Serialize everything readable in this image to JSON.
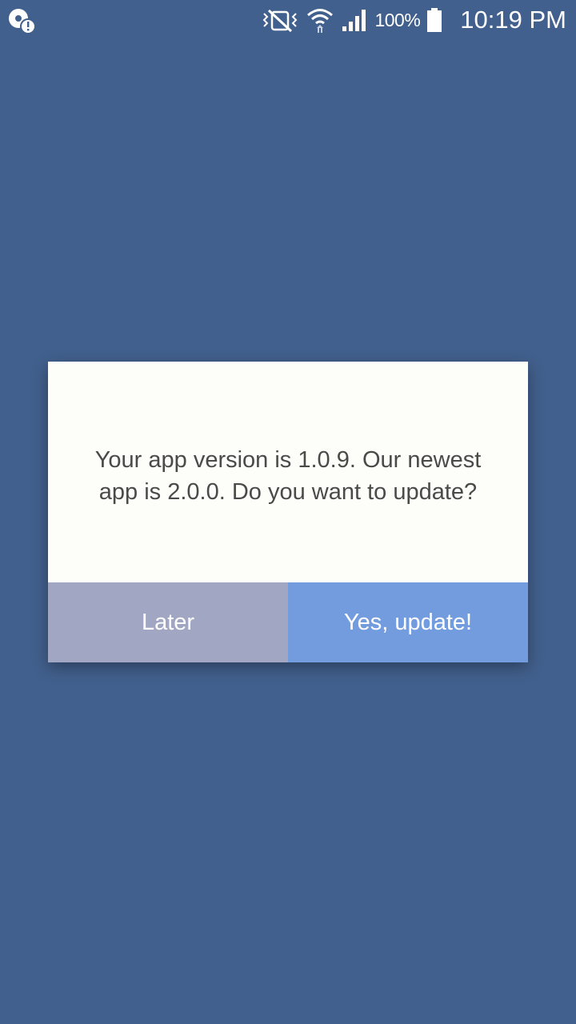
{
  "status_bar": {
    "left_icon": "sync-alert-icon",
    "icons": [
      "vibrate-mute-icon",
      "wifi-icon",
      "signal-icon",
      "battery-icon"
    ],
    "battery": "100%",
    "time": "10:19 PM"
  },
  "dialog": {
    "message": "Your app version is 1.0.9. Our newest app is 2.0.0. Do you want to update?",
    "later_label": "Later",
    "update_label": "Yes, update!"
  },
  "colors": {
    "background": "#42608d",
    "dialog": "#fdfef9",
    "later_button": "#a1a7c3",
    "update_button": "#739cde"
  }
}
